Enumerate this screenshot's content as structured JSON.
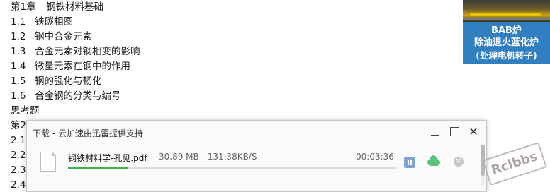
{
  "toc": {
    "lines": [
      {
        "num": "第1章",
        "text": "钢铁材料基础"
      },
      {
        "num": "1.1",
        "text": "铁碳相图"
      },
      {
        "num": "1.2",
        "text": "钢中合金元素"
      },
      {
        "num": "1.3",
        "text": "合金元素对钢相变的影响"
      },
      {
        "num": "1.4",
        "text": "微量元素在钢中的作用"
      },
      {
        "num": "1.5",
        "text": "钢的强化与韧化"
      },
      {
        "num": "1.6",
        "text": "合金钢的分类与编号"
      },
      {
        "num": "",
        "text": "思考题"
      },
      {
        "num": "第2",
        "text": ""
      },
      {
        "num": "2.1",
        "text": ""
      },
      {
        "num": "2.2",
        "text": ""
      },
      {
        "num": "2.3",
        "text": ""
      },
      {
        "num": "2.4",
        "text": ""
      }
    ]
  },
  "ad": {
    "line1": "BAB炉",
    "line2": "除油退火蓝化炉",
    "line3": "(处理电机转子)"
  },
  "download_panel": {
    "title": "下载 - 云加速由迅雷提供支持",
    "file": {
      "name": "钢铁材料学-孔见.pdf",
      "size_speed": "30.89 MB - 131.38KB/S",
      "time": "00:03:36",
      "progress": 0.18
    }
  },
  "watermark": "Rclbbs"
}
